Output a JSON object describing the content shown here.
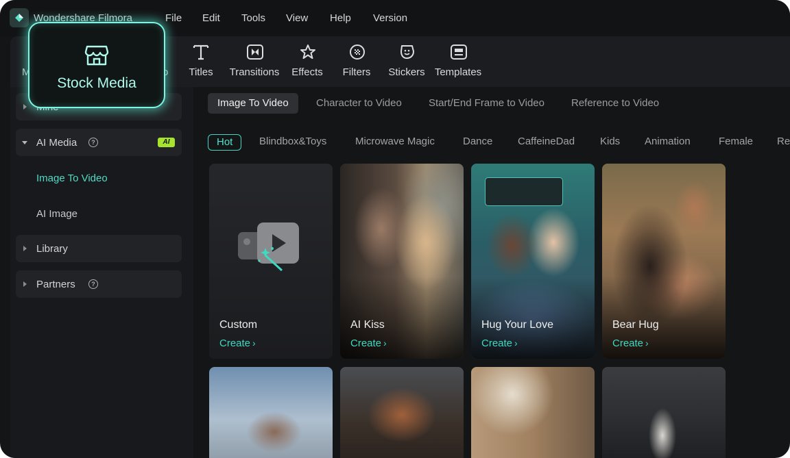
{
  "app": {
    "title": "Wondershare Filmora"
  },
  "menu": [
    "File",
    "Edit",
    "Tools",
    "View",
    "Help",
    "Version"
  ],
  "toolbar": {
    "tools": [
      {
        "label": "Titles",
        "icon": "titles-icon"
      },
      {
        "label": "Transitions",
        "icon": "transitions-icon"
      },
      {
        "label": "Effects",
        "icon": "effects-icon"
      },
      {
        "label": "Filters",
        "icon": "filters-icon"
      },
      {
        "label": "Stickers",
        "icon": "stickers-icon"
      },
      {
        "label": "Templates",
        "icon": "templates-icon"
      }
    ],
    "partial_left": "M",
    "partial_right": "o",
    "highlight": {
      "label": "Stock Media",
      "icon": "store-icon",
      "accent": "#7ff4e4"
    }
  },
  "sidebar": {
    "mine": "Mine",
    "ai_media": {
      "label": "AI Media",
      "badge": "AI"
    },
    "sub_items": [
      {
        "label": "Image To Video",
        "active": true
      },
      {
        "label": "AI Image",
        "active": false
      }
    ],
    "library": "Library",
    "partners": "Partners",
    "help_glyph": "?"
  },
  "tabs": [
    "Image To Video",
    "Character to Video",
    "Start/End Frame to Video",
    "Reference to Video"
  ],
  "categories": [
    "Hot",
    "Blindbox&Toys",
    "Microwave Magic",
    "Dance",
    "CaffeineDad",
    "Kids",
    "Animation",
    "Female",
    "Rel"
  ],
  "cards": [
    {
      "title": "Custom",
      "action": "Create"
    },
    {
      "title": "AI Kiss",
      "action": "Create"
    },
    {
      "title": "Hug Your Love",
      "action": "Create"
    },
    {
      "title": "Bear Hug",
      "action": "Create"
    }
  ],
  "arrow_glyph": "›",
  "colors": {
    "accent": "#3fd9c1",
    "background": "#141517",
    "panel": "#18191c"
  }
}
